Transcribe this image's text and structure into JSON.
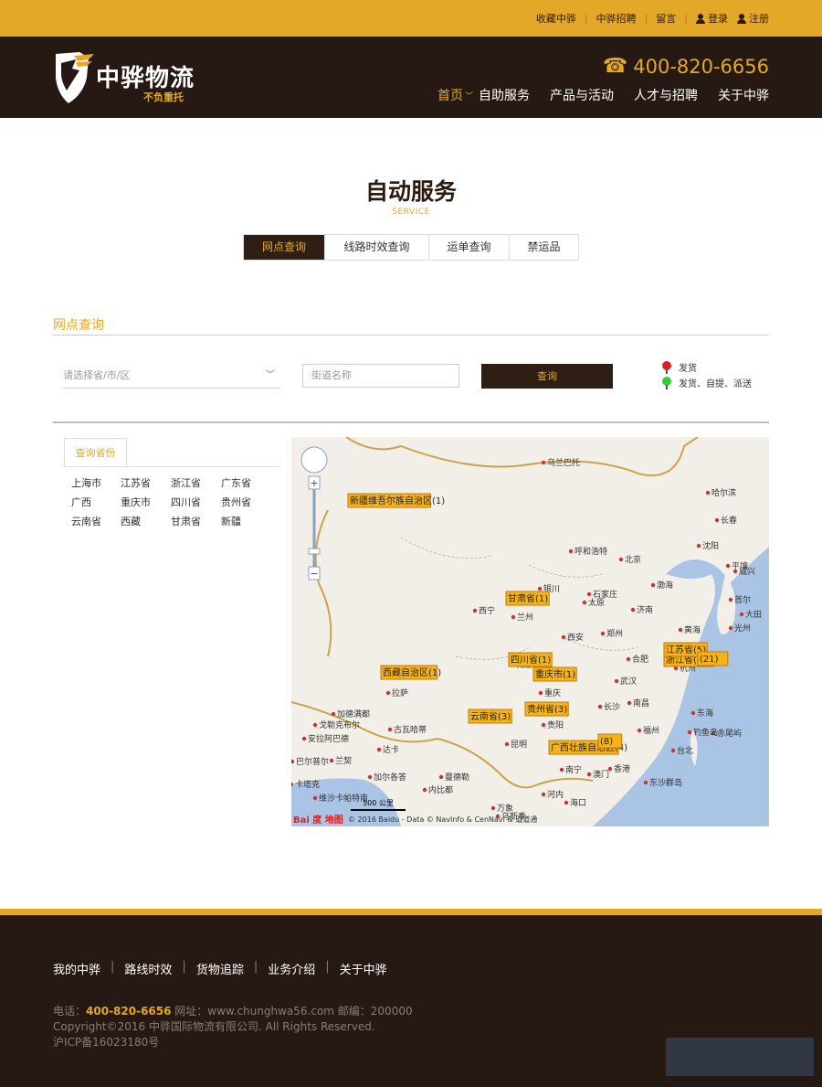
{
  "topbar": {
    "links": [
      "收藏中骅",
      "中骅招聘",
      "留言"
    ],
    "login": "登录",
    "register": "注册"
  },
  "header": {
    "brand": "中骅物流",
    "slogan": "不负重托",
    "phone": "400-820-6656",
    "nav": [
      {
        "label": "首页",
        "active": true
      },
      {
        "label": "自助服务"
      },
      {
        "label": "产品与活动"
      },
      {
        "label": "人才与招聘"
      },
      {
        "label": "关于中骅"
      }
    ]
  },
  "page": {
    "title": "自动服务",
    "subtitle": "SERVICE"
  },
  "tabs": [
    "网点查询",
    "线路时效查询",
    "运单查询",
    "禁运品"
  ],
  "search": {
    "section_title": "网点查询",
    "region_placeholder": "请选择省/市/区",
    "street_placeholder": "街道名称",
    "button": "查询"
  },
  "legend": [
    {
      "label": "发货",
      "color": "#e02020"
    },
    {
      "label": "发货、自提、派送",
      "color": "#33cc33"
    }
  ],
  "provinces": {
    "tab": "查询省份",
    "items": [
      "上海市",
      "江苏省",
      "浙江省",
      "广东省",
      "广西",
      "重庆市",
      "四川省",
      "贵州省",
      "云南省",
      "西藏",
      "甘肃省",
      "新疆"
    ]
  },
  "map": {
    "cities": [
      "乌兰巴托",
      "哈尔滨",
      "长春",
      "沈阳",
      "呼和浩特",
      "北京",
      "渤海",
      "平壤",
      "威兴",
      "首尔",
      "大田",
      "光州",
      "银川",
      "石家庄",
      "济南",
      "太原",
      "西宁",
      "兰州",
      "郑州",
      "西安",
      "黄海",
      "合肥",
      "武汉",
      "成都",
      "拉萨",
      "重庆",
      "长沙",
      "南昌",
      "东海",
      "加德满都",
      "戈勒克布尔",
      "安拉阿巴德",
      "古瓦哈蒂",
      "达卡",
      "贵阳",
      "昆明",
      "福州",
      "台北",
      "赤尾屿",
      "钓鱼岛",
      "巴尔普尔",
      "兰契",
      "加尔各答",
      "曼德勒",
      "南宁",
      "澳门",
      "香港",
      "东沙群岛",
      "卡塔克",
      "维沙卡帕特南",
      "内比都",
      "河内",
      "海口",
      "万象",
      "乌斯季",
      "杭州"
    ],
    "markers": [
      "新疆维吾尔族自治区(1)",
      "甘肃省(1)",
      "四川省(1)",
      "重庆市(1)",
      "西藏自治区(1)",
      "云南省(3)",
      "贵州省(3)",
      "广西壮族自治区(4)",
      "浙江省(41)",
      "江苏省(5)",
      "(21)",
      "(8)"
    ],
    "scale": "500 公里",
    "copyright": "© 2016 Baidu - Data © NavInfo & CenNavi & 道道通",
    "logo": "Bai 度 地图"
  },
  "footer": {
    "nav": [
      "我的中骅",
      "路线时效",
      "货物追踪",
      "业务介绍",
      "关于中骅"
    ],
    "phone_label": "电话：",
    "phone": "400-820-6656",
    "site_label": " 网址：www.chunghwa56.com 邮编：200000",
    "copyright": "Copyright©2016 中骅国际物流有限公司. All Rights Reserved.",
    "icp": "沪ICP备16023180号"
  },
  "colors": {
    "accent": "#e4a829",
    "dark": "#261913"
  }
}
